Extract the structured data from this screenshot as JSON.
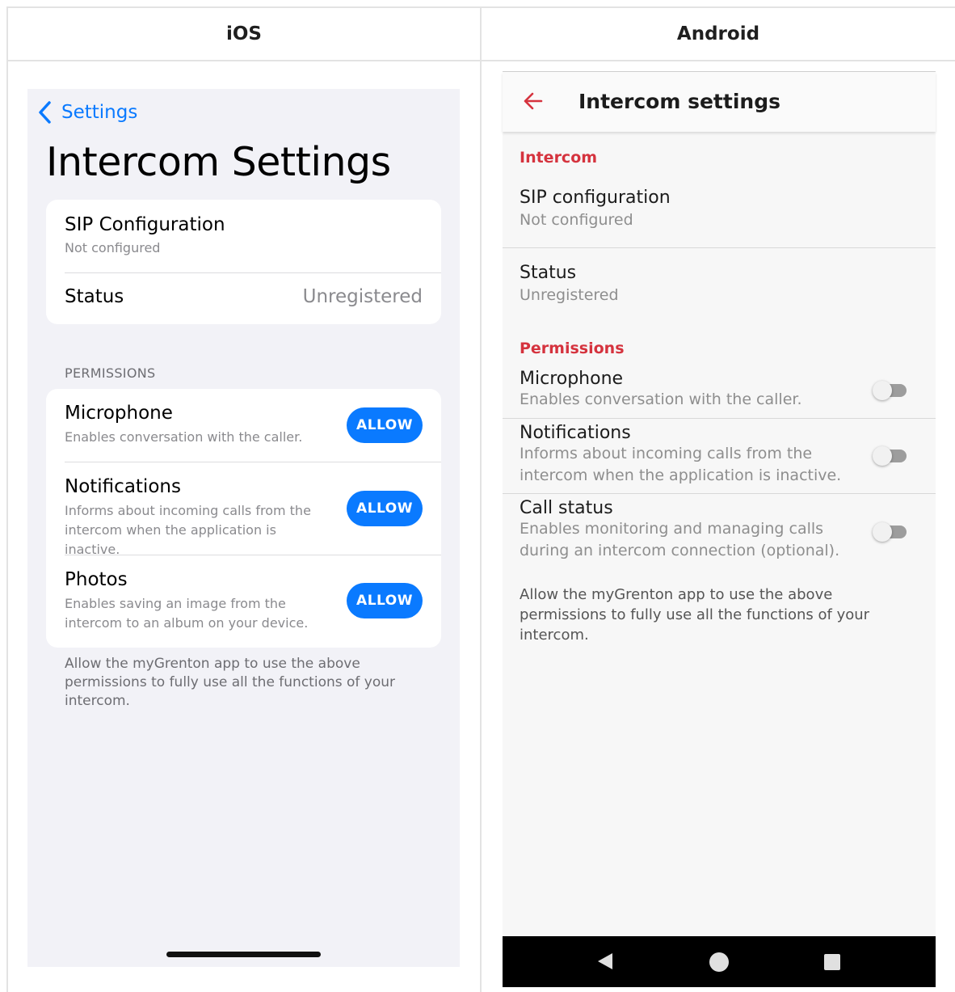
{
  "columns": {
    "ios": "iOS",
    "android": "Android"
  },
  "ios": {
    "back_label": "Settings",
    "title": "Intercom Settings",
    "sip": {
      "label": "SIP Configuration",
      "sub": "Not configured"
    },
    "status": {
      "label": "Status",
      "value": "Unregistered"
    },
    "permissions_header": "PERMISSIONS",
    "permissions": [
      {
        "label": "Microphone",
        "sub": "Enables conversation with the caller.",
        "button": "ALLOW"
      },
      {
        "label": "Notifications",
        "sub": "Informs about incoming calls from the intercom when the application is inactive.",
        "button": "ALLOW"
      },
      {
        "label": "Photos",
        "sub": "Enables saving an image from the intercom to an album on your device.",
        "button": "ALLOW"
      }
    ],
    "footer": "Allow the myGrenton app to use the above permissions to fully use all the functions of your intercom.",
    "accent": "#0a7aff"
  },
  "android": {
    "title": "Intercom settings",
    "intercom_section": "Intercom",
    "sip": {
      "label": "SIP configuration",
      "sub": "Not configured"
    },
    "status": {
      "label": "Status",
      "sub": "Unregistered"
    },
    "permissions_section": "Permissions",
    "permissions": [
      {
        "label": "Microphone",
        "sub": "Enables conversation with the caller.",
        "enabled": false
      },
      {
        "label": "Notifications",
        "sub": "Informs about incoming calls from the intercom when the application is inactive.",
        "enabled": false
      },
      {
        "label": "Call status",
        "sub": "Enables monitoring and managing calls during an intercom connection (optional).",
        "enabled": false
      }
    ],
    "footer": "Allow the myGrenton app to use the above permissions to fully use all the functions of your intercom.",
    "accent": "#d5333e",
    "nav_icons": [
      "back-triangle-icon",
      "home-circle-icon",
      "recents-square-icon"
    ]
  }
}
